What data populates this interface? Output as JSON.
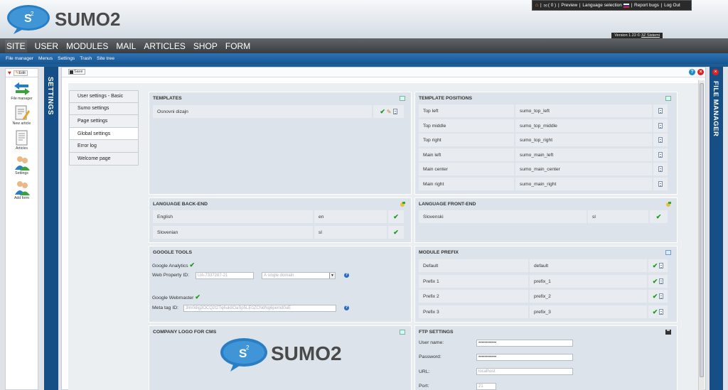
{
  "logo": {
    "text": "SUMO2",
    "superscript": "2",
    "bubble_letter": "S"
  },
  "top_links": {
    "messages": "( 0 )",
    "preview": "Preview",
    "language": "Language selection",
    "report": "Report bugs",
    "logout": "Log Out"
  },
  "version": {
    "text": "Version 1.22 ©",
    "company": "3Z Sistemi"
  },
  "main_nav": [
    "SITE",
    "USER",
    "MODULES",
    "MAIL",
    "ARTICLES",
    "SHOP",
    "FORM"
  ],
  "sub_nav": [
    "File manager",
    "Menus",
    "Settings",
    "Trash",
    "Site tree"
  ],
  "toolbox": {
    "edit": "Edit",
    "items": [
      "File manager",
      "New article",
      "Articles",
      "Settings",
      "Add form"
    ]
  },
  "bars": {
    "left": "SETTINGS",
    "right": "FILE MANAGER"
  },
  "toolbar": {
    "save": "Save"
  },
  "side_menu": [
    "User settings - Basic",
    "Sumo settings",
    "Page settings",
    "Global settings",
    "Error log",
    "Welcome page"
  ],
  "templates": {
    "title": "TEMPLATES",
    "rows": [
      "Osnovni dizajn"
    ]
  },
  "template_positions": {
    "title": "TEMPLATE POSITIONS",
    "rows": [
      {
        "name": "Top left",
        "value": "sumo_top_left"
      },
      {
        "name": "Top middle",
        "value": "sumo_top_middle"
      },
      {
        "name": "Top right",
        "value": "sumo_top_right"
      },
      {
        "name": "Main left",
        "value": "sumo_main_left"
      },
      {
        "name": "Main center",
        "value": "sumo_main_center"
      },
      {
        "name": "Main right",
        "value": "sumo_main_right"
      }
    ]
  },
  "language_backend": {
    "title": "LANGUAGE BACK-END",
    "rows": [
      {
        "name": "English",
        "code": "en"
      },
      {
        "name": "Slovenian",
        "code": "sl"
      }
    ]
  },
  "language_frontend": {
    "title": "LANGUAGE FRONT-END",
    "rows": [
      {
        "name": "Slovenski",
        "code": "sl"
      }
    ]
  },
  "google_tools": {
    "title": "GOOGLE TOOLS",
    "analytics": "Google Analytics",
    "web_property_label": "Web Property ID:",
    "web_property_value": "UA-7337287-21",
    "domain_select": "A single domain",
    "webmaster": "Google Webmaster",
    "meta_label": "Meta tag ID:",
    "meta_value": "3lm0dig3OCQ2t2Tq6uk8OaSp5LE0ZCNdNg6pemd0uE"
  },
  "module_prefix": {
    "title": "MODULE PREFIX",
    "rows": [
      {
        "name": "Default",
        "value": "default"
      },
      {
        "name": "Prefix 1",
        "value": "prefix_1"
      },
      {
        "name": "Prefix 2",
        "value": "prefix_2"
      },
      {
        "name": "Prefix 3",
        "value": "prefix_3"
      }
    ]
  },
  "company_logo": {
    "title": "COMPANY LOGO FOR CMS",
    "logo_text": "SUMO2"
  },
  "ftp": {
    "title": "FTP SETTINGS",
    "username_label": "User name:",
    "username_value": "••••••••••••",
    "password_label": "Password:",
    "password_value": "••••••••••••",
    "url_label": "URL:",
    "url_value": "localhost",
    "port_label": "Port:",
    "port_value": "21"
  }
}
